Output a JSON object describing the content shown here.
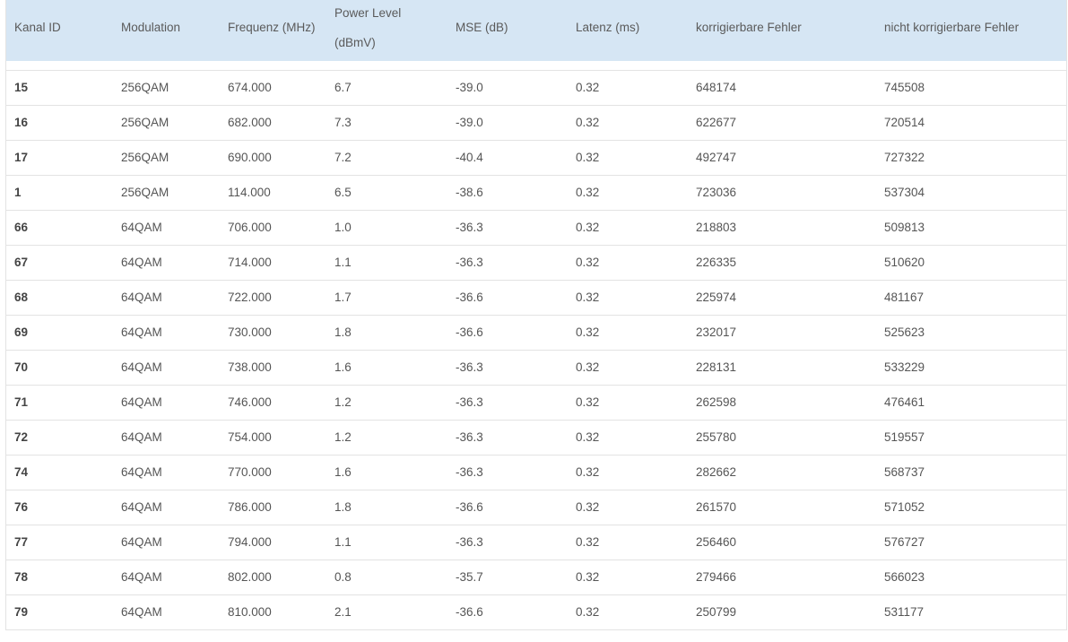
{
  "table": {
    "headers": [
      "Kanal ID",
      "Modulation",
      "Frequenz (MHz)",
      "Power Level",
      "MSE (dB)",
      "Latenz (ms)",
      "korrigierbare Fehler",
      "nicht korrigierbare Fehler"
    ],
    "header_power_unit": "(dBmV)",
    "rows": [
      [
        "15",
        "256QAM",
        "674.000",
        "6.7",
        "-39.0",
        "0.32",
        "648174",
        "745508"
      ],
      [
        "16",
        "256QAM",
        "682.000",
        "7.3",
        "-39.0",
        "0.32",
        "622677",
        "720514"
      ],
      [
        "17",
        "256QAM",
        "690.000",
        "7.2",
        "-40.4",
        "0.32",
        "492747",
        "727322"
      ],
      [
        "1",
        "256QAM",
        "114.000",
        "6.5",
        "-38.6",
        "0.32",
        "723036",
        "537304"
      ],
      [
        "66",
        "64QAM",
        "706.000",
        "1.0",
        "-36.3",
        "0.32",
        "218803",
        "509813"
      ],
      [
        "67",
        "64QAM",
        "714.000",
        "1.1",
        "-36.3",
        "0.32",
        "226335",
        "510620"
      ],
      [
        "68",
        "64QAM",
        "722.000",
        "1.7",
        "-36.6",
        "0.32",
        "225974",
        "481167"
      ],
      [
        "69",
        "64QAM",
        "730.000",
        "1.8",
        "-36.6",
        "0.32",
        "232017",
        "525623"
      ],
      [
        "70",
        "64QAM",
        "738.000",
        "1.6",
        "-36.3",
        "0.32",
        "228131",
        "533229"
      ],
      [
        "71",
        "64QAM",
        "746.000",
        "1.2",
        "-36.3",
        "0.32",
        "262598",
        "476461"
      ],
      [
        "72",
        "64QAM",
        "754.000",
        "1.2",
        "-36.3",
        "0.32",
        "255780",
        "519557"
      ],
      [
        "74",
        "64QAM",
        "770.000",
        "1.6",
        "-36.3",
        "0.32",
        "282662",
        "568737"
      ],
      [
        "76",
        "64QAM",
        "786.000",
        "1.8",
        "-36.6",
        "0.32",
        "261570",
        "571052"
      ],
      [
        "77",
        "64QAM",
        "794.000",
        "1.1",
        "-36.3",
        "0.32",
        "256460",
        "576727"
      ],
      [
        "78",
        "64QAM",
        "802.000",
        "0.8",
        "-35.7",
        "0.32",
        "279466",
        "566023"
      ],
      [
        "79",
        "64QAM",
        "810.000",
        "2.1",
        "-36.6",
        "0.32",
        "250799",
        "531177"
      ]
    ]
  },
  "colors": {
    "header_bg": "#d6e6f4",
    "border": "#e3e3e3",
    "text": "#555555"
  }
}
